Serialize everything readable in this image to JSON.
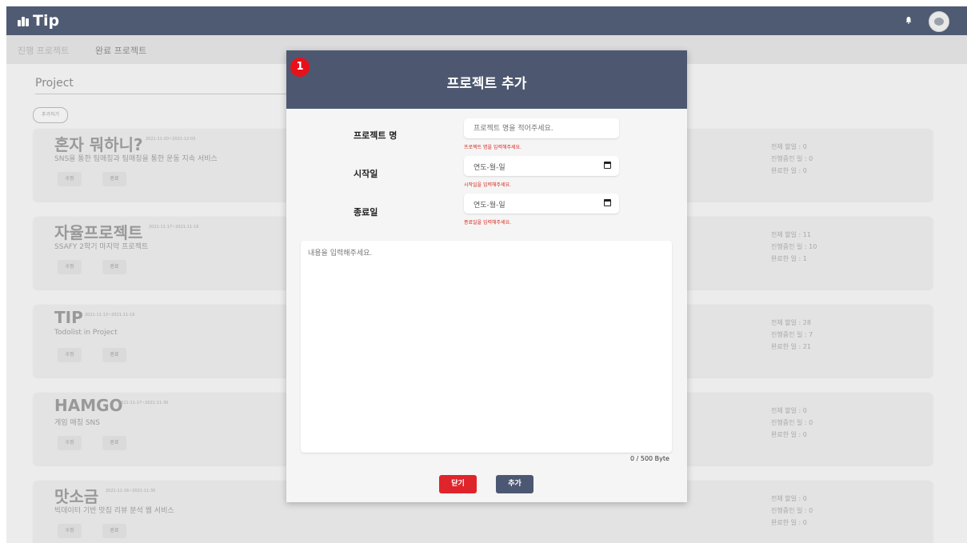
{
  "app": {
    "logo": "Tip"
  },
  "nav": {
    "tabs": [
      "진행 프로젝트",
      "완료 프로젝트"
    ]
  },
  "section": {
    "title": "Project",
    "add_button": "추가하기"
  },
  "projects": [
    {
      "title": "혼자 뭐하니?",
      "date": "2021-11-20~2021-12-03",
      "desc": "SNS을 통한 팀매칭과 팀매칭을 통한 운동 지속 서비스",
      "edit": "수정",
      "done": "완료",
      "total": "전체 할일 : 0",
      "progress": "진행중인 일 : 0",
      "complete": "완료한 일 : 0"
    },
    {
      "title": "자율프로젝트",
      "date": "2021-11-17~2021-11-19",
      "desc": "SSAFY 2학기 마지막 프로젝트",
      "edit": "수정",
      "done": "완료",
      "total": "전체 할일 : 11",
      "progress": "진행중인 일 : 10",
      "complete": "완료한 일 : 1"
    },
    {
      "title": "TIP",
      "date": "2021-11-13~2021-11-19",
      "desc": "Todolist in Project",
      "edit": "수정",
      "done": "완료",
      "total": "전체 할일 : 28",
      "progress": "진행중인 일 : 7",
      "complete": "완료한 일 : 21"
    },
    {
      "title": "HAMGO",
      "date": "2021-11-17~2021-11-30",
      "desc": "게임 매칭 SNS",
      "edit": "수정",
      "done": "완료",
      "total": "전체 할일 : 0",
      "progress": "진행중인 일 : 0",
      "complete": "완료한 일 : 0"
    },
    {
      "title": "맛소금",
      "date": "2021-11-16~2021-11-30",
      "desc": "빅데이터 기반 맛집 리뷰 분석 웹 서비스",
      "edit": "수정",
      "done": "완료",
      "total": "전체 할일 : 0",
      "progress": "진행중인 일 : 0",
      "complete": "완료한 일 : 0"
    }
  ],
  "modal": {
    "badge": "1",
    "title": "프로젝트 추가",
    "name_label": "프로젝트 명",
    "name_placeholder": "프로젝트 명을 적어주세요.",
    "name_error": "프로젝트 명을 입력해주세요.",
    "start_label": "시작일",
    "start_value": "연도-월-일",
    "start_error": "시작일을 입력해주세요.",
    "end_label": "종료일",
    "end_value": "연도-월-일",
    "end_error": "종료일을 입력해주세요.",
    "content_placeholder": "내용을 입력해주세요.",
    "counter": "0 / 500 Byte",
    "close_button": "닫기",
    "add_button": "추가"
  },
  "colors": {
    "header": "#4f5b72",
    "modal_header": "#4d5870",
    "close": "#e0242b",
    "add": "#4c5873",
    "error": "#d4281e",
    "badge": "#e8111a"
  },
  "icons": {
    "bell": "bell-icon",
    "avatar": "avatar",
    "calendar": "calendar-icon",
    "logo": "logo-icon"
  }
}
